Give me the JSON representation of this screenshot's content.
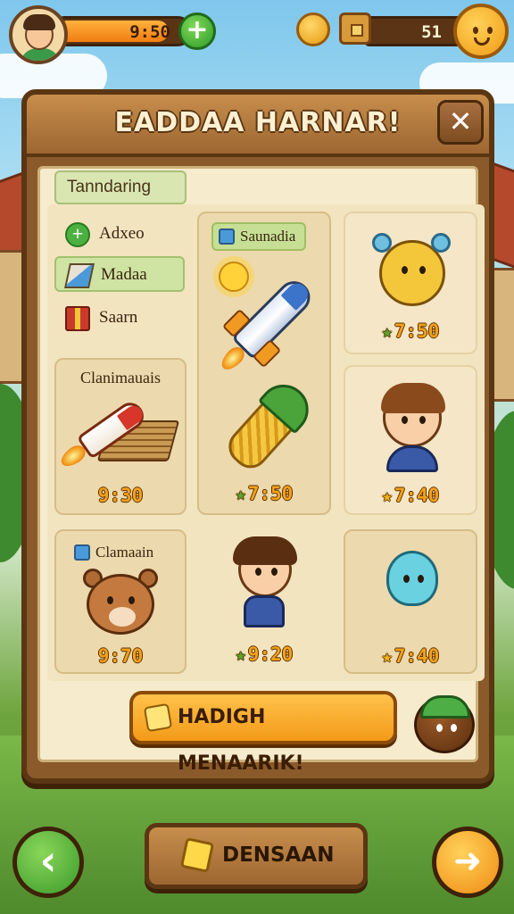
{
  "hud": {
    "xp_value": "9:50",
    "xp_fill_percent": 82,
    "currency_value": "51",
    "plus_icon": "plus-icon",
    "coin_icon": "coin-face-icon",
    "chest_icon": "treasure-chest-icon",
    "profile_icon": "mascot-face-icon"
  },
  "panel": {
    "title": "EADDAA HARNAR!",
    "close_label": "✕",
    "section_label": "Tanndaring"
  },
  "menu": [
    {
      "label": "Adxeo",
      "icon": "plus-circle-icon",
      "active": false
    },
    {
      "label": "Madaa",
      "icon": "book-icon",
      "active": true
    },
    {
      "label": "Saarn",
      "icon": "gift-box-icon",
      "active": false
    }
  ],
  "cards": {
    "rocket_featured": {
      "label": "Saunadia",
      "icon": "cube-icon"
    },
    "bear_yellow": {
      "price": "7:50",
      "star": "green"
    },
    "money_rocket": {
      "title": "Clanimauais",
      "price": "9:30"
    },
    "corn": {
      "price": "7:50",
      "star": "green"
    },
    "girl": {
      "price": "7:40",
      "star": "gold"
    },
    "bear_brown": {
      "label": "Clamaain",
      "icon": "cube-icon",
      "price": "9:70"
    },
    "boy": {
      "price": "9:20",
      "star": "green"
    },
    "drop": {
      "price": "7:40",
      "star": "gold"
    }
  },
  "cta": {
    "label": "HADIGH MENAARIK!",
    "icon": "gold-bar-icon"
  },
  "bottom": {
    "back_label": "‹",
    "next_label": "➜",
    "center_label": "DENSAAN",
    "center_icon": "gold-bar-icon"
  },
  "colors": {
    "accent_orange": "#f39a18",
    "wood": "#9d6631",
    "parchment": "#f6ebcc",
    "green_button": "#3a9a2a"
  }
}
